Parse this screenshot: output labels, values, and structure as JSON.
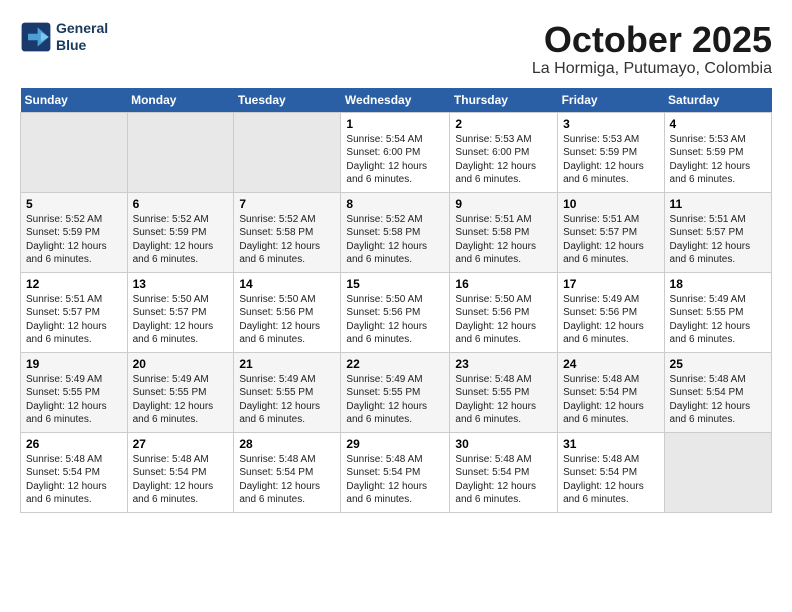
{
  "logo": {
    "line1": "General",
    "line2": "Blue"
  },
  "title": "October 2025",
  "subtitle": "La Hormiga, Putumayo, Colombia",
  "days_of_week": [
    "Sunday",
    "Monday",
    "Tuesday",
    "Wednesday",
    "Thursday",
    "Friday",
    "Saturday"
  ],
  "weeks": [
    [
      {
        "day": "",
        "info": ""
      },
      {
        "day": "",
        "info": ""
      },
      {
        "day": "",
        "info": ""
      },
      {
        "day": "1",
        "info": "Sunrise: 5:54 AM\nSunset: 6:00 PM\nDaylight: 12 hours and 6 minutes."
      },
      {
        "day": "2",
        "info": "Sunrise: 5:53 AM\nSunset: 6:00 PM\nDaylight: 12 hours and 6 minutes."
      },
      {
        "day": "3",
        "info": "Sunrise: 5:53 AM\nSunset: 5:59 PM\nDaylight: 12 hours and 6 minutes."
      },
      {
        "day": "4",
        "info": "Sunrise: 5:53 AM\nSunset: 5:59 PM\nDaylight: 12 hours and 6 minutes."
      }
    ],
    [
      {
        "day": "5",
        "info": "Sunrise: 5:52 AM\nSunset: 5:59 PM\nDaylight: 12 hours and 6 minutes."
      },
      {
        "day": "6",
        "info": "Sunrise: 5:52 AM\nSunset: 5:59 PM\nDaylight: 12 hours and 6 minutes."
      },
      {
        "day": "7",
        "info": "Sunrise: 5:52 AM\nSunset: 5:58 PM\nDaylight: 12 hours and 6 minutes."
      },
      {
        "day": "8",
        "info": "Sunrise: 5:52 AM\nSunset: 5:58 PM\nDaylight: 12 hours and 6 minutes."
      },
      {
        "day": "9",
        "info": "Sunrise: 5:51 AM\nSunset: 5:58 PM\nDaylight: 12 hours and 6 minutes."
      },
      {
        "day": "10",
        "info": "Sunrise: 5:51 AM\nSunset: 5:57 PM\nDaylight: 12 hours and 6 minutes."
      },
      {
        "day": "11",
        "info": "Sunrise: 5:51 AM\nSunset: 5:57 PM\nDaylight: 12 hours and 6 minutes."
      }
    ],
    [
      {
        "day": "12",
        "info": "Sunrise: 5:51 AM\nSunset: 5:57 PM\nDaylight: 12 hours and 6 minutes."
      },
      {
        "day": "13",
        "info": "Sunrise: 5:50 AM\nSunset: 5:57 PM\nDaylight: 12 hours and 6 minutes."
      },
      {
        "day": "14",
        "info": "Sunrise: 5:50 AM\nSunset: 5:56 PM\nDaylight: 12 hours and 6 minutes."
      },
      {
        "day": "15",
        "info": "Sunrise: 5:50 AM\nSunset: 5:56 PM\nDaylight: 12 hours and 6 minutes."
      },
      {
        "day": "16",
        "info": "Sunrise: 5:50 AM\nSunset: 5:56 PM\nDaylight: 12 hours and 6 minutes."
      },
      {
        "day": "17",
        "info": "Sunrise: 5:49 AM\nSunset: 5:56 PM\nDaylight: 12 hours and 6 minutes."
      },
      {
        "day": "18",
        "info": "Sunrise: 5:49 AM\nSunset: 5:55 PM\nDaylight: 12 hours and 6 minutes."
      }
    ],
    [
      {
        "day": "19",
        "info": "Sunrise: 5:49 AM\nSunset: 5:55 PM\nDaylight: 12 hours and 6 minutes."
      },
      {
        "day": "20",
        "info": "Sunrise: 5:49 AM\nSunset: 5:55 PM\nDaylight: 12 hours and 6 minutes."
      },
      {
        "day": "21",
        "info": "Sunrise: 5:49 AM\nSunset: 5:55 PM\nDaylight: 12 hours and 6 minutes."
      },
      {
        "day": "22",
        "info": "Sunrise: 5:49 AM\nSunset: 5:55 PM\nDaylight: 12 hours and 6 minutes."
      },
      {
        "day": "23",
        "info": "Sunrise: 5:48 AM\nSunset: 5:55 PM\nDaylight: 12 hours and 6 minutes."
      },
      {
        "day": "24",
        "info": "Sunrise: 5:48 AM\nSunset: 5:54 PM\nDaylight: 12 hours and 6 minutes."
      },
      {
        "day": "25",
        "info": "Sunrise: 5:48 AM\nSunset: 5:54 PM\nDaylight: 12 hours and 6 minutes."
      }
    ],
    [
      {
        "day": "26",
        "info": "Sunrise: 5:48 AM\nSunset: 5:54 PM\nDaylight: 12 hours and 6 minutes."
      },
      {
        "day": "27",
        "info": "Sunrise: 5:48 AM\nSunset: 5:54 PM\nDaylight: 12 hours and 6 minutes."
      },
      {
        "day": "28",
        "info": "Sunrise: 5:48 AM\nSunset: 5:54 PM\nDaylight: 12 hours and 6 minutes."
      },
      {
        "day": "29",
        "info": "Sunrise: 5:48 AM\nSunset: 5:54 PM\nDaylight: 12 hours and 6 minutes."
      },
      {
        "day": "30",
        "info": "Sunrise: 5:48 AM\nSunset: 5:54 PM\nDaylight: 12 hours and 6 minutes."
      },
      {
        "day": "31",
        "info": "Sunrise: 5:48 AM\nSunset: 5:54 PM\nDaylight: 12 hours and 6 minutes."
      },
      {
        "day": "",
        "info": ""
      }
    ]
  ]
}
